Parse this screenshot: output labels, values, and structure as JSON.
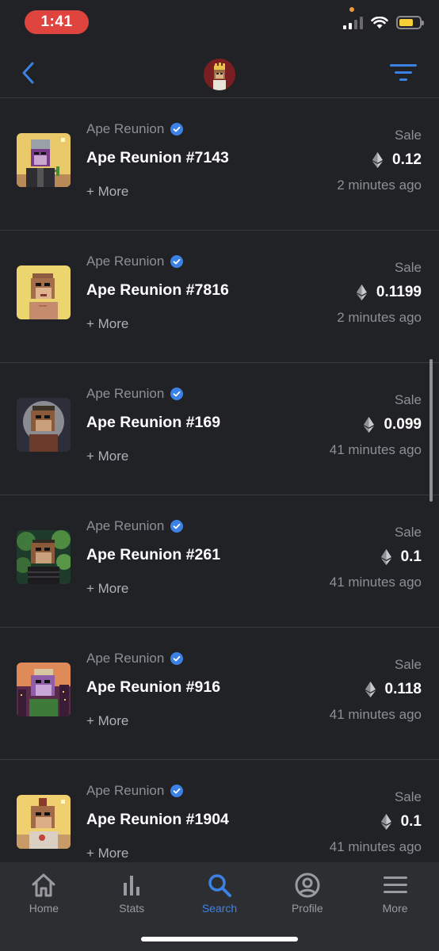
{
  "status_bar": {
    "time": "1:41"
  },
  "nav": {
    "back_icon": "chevron-left-icon",
    "filter_icon": "filter-icon"
  },
  "colors": {
    "accent": "#3c82e6",
    "background": "#212226",
    "tab_bar": "#2d2e32",
    "time_pill": "#e0443e"
  },
  "sales": [
    {
      "collection": "Ape Reunion",
      "title": "Ape Reunion #7143",
      "more": "+ More",
      "event": "Sale",
      "price": "0.12",
      "time": "2 minutes ago"
    },
    {
      "collection": "Ape Reunion",
      "title": "Ape Reunion #7816",
      "more": "+ More",
      "event": "Sale",
      "price": "0.1199",
      "time": "2 minutes ago"
    },
    {
      "collection": "Ape Reunion",
      "title": "Ape Reunion #169",
      "more": "+ More",
      "event": "Sale",
      "price": "0.099",
      "time": "41 minutes ago"
    },
    {
      "collection": "Ape Reunion",
      "title": "Ape Reunion #261",
      "more": "+ More",
      "event": "Sale",
      "price": "0.1",
      "time": "41 minutes ago"
    },
    {
      "collection": "Ape Reunion",
      "title": "Ape Reunion #916",
      "more": "+ More",
      "event": "Sale",
      "price": "0.118",
      "time": "41 minutes ago"
    },
    {
      "collection": "Ape Reunion",
      "title": "Ape Reunion #1904",
      "more": "+ More",
      "event": "Sale",
      "price": "0.1",
      "time": "41 minutes ago"
    }
  ],
  "tabs": [
    {
      "label": "Home",
      "icon": "home-icon",
      "active": false
    },
    {
      "label": "Stats",
      "icon": "stats-icon",
      "active": false
    },
    {
      "label": "Search",
      "icon": "search-icon",
      "active": true
    },
    {
      "label": "Profile",
      "icon": "profile-icon",
      "active": false
    },
    {
      "label": "More",
      "icon": "menu-icon",
      "active": false
    }
  ]
}
